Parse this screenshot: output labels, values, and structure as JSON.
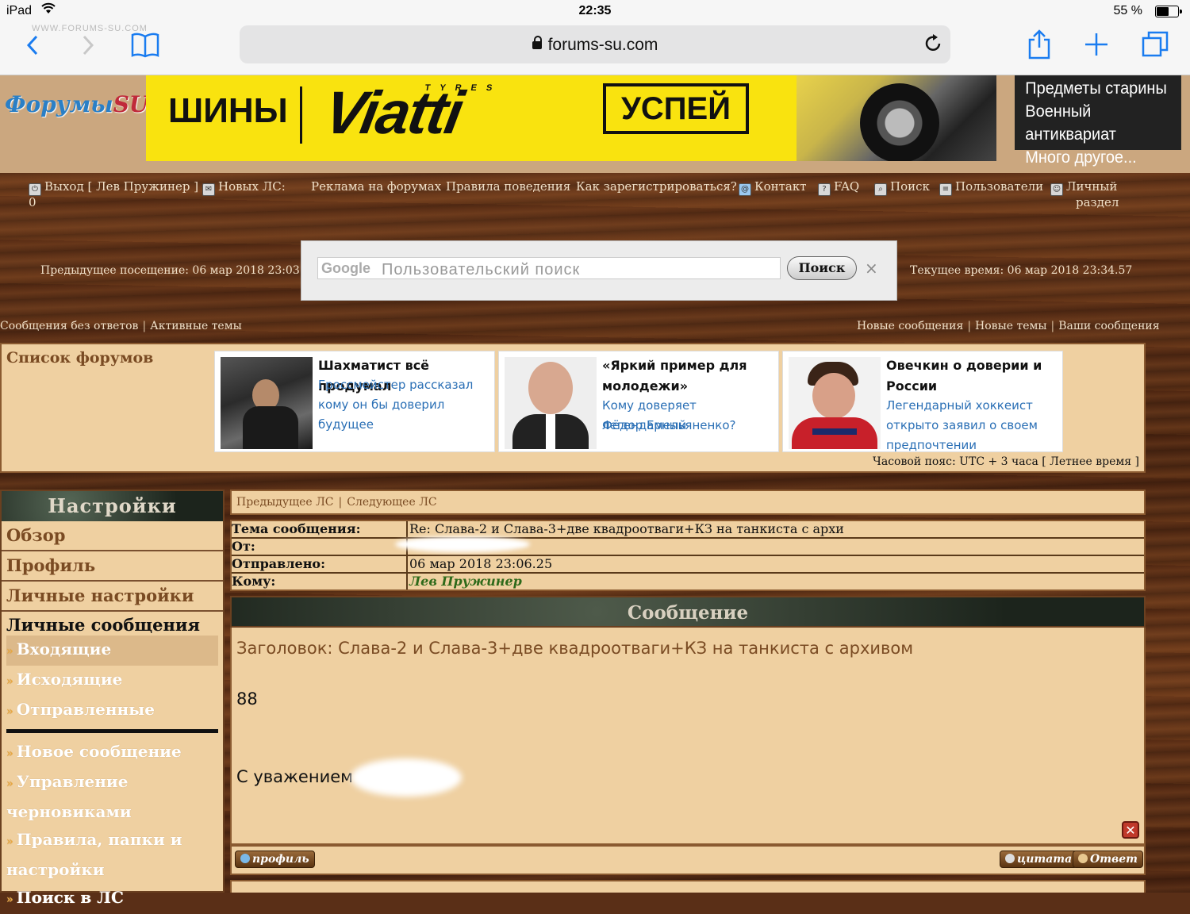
{
  "status": {
    "device": "iPad",
    "time": "22:35",
    "battery": "55 %"
  },
  "browser": {
    "watermark": "WWW.FORUMS-SU.COM",
    "url": "forums-su.com"
  },
  "banner": {
    "logo_main": "Форумы",
    "logo_accent": "SU",
    "ad_word": "ШИНЫ",
    "ad_brand": "Viatti",
    "ad_brand_sub": "TYRES",
    "ad_cta": "УСПЕЙ",
    "side_ad": [
      "Предметы старины",
      "Военный антиквариат",
      "Много другое..."
    ]
  },
  "topnav": {
    "logout": "Выход [ Лев Пружинер ]",
    "new_pm": "Новых ЛС:",
    "new_pm_count": "0",
    "ads": "Реклама на форумах",
    "rules": "Правила поведения",
    "register": "Как зарегистрироваться?",
    "contact": "Контакт",
    "faq": "FAQ",
    "search": "Поиск",
    "users": "Пользователи",
    "personal_1": "Личный",
    "personal_2": "раздел"
  },
  "visit": {
    "previous": "Предыдущее посещение: 06 мар 2018 23:03.56",
    "current": "Текущее время: 06 мар 2018 23:34.57"
  },
  "gsearch": {
    "logo": "Google",
    "placeholder": "Пользовательский поиск",
    "button": "Поиск",
    "clear": "×"
  },
  "sublinks": {
    "left": [
      "Сообщения без ответов",
      "Активные темы"
    ],
    "right": [
      "Новые сообщения",
      "Новые темы",
      "Ваши сообщения"
    ]
  },
  "forumlist": {
    "title": "Список форумов",
    "cards": [
      {
        "headline": "Шахматист всё продумал",
        "desc": [
          "Гроссмейстер рассказал",
          "кому он бы доверил",
          "будущее"
        ]
      },
      {
        "headline_1": "«Яркий пример для",
        "headline_2": "молодежи»",
        "desc": [
          "Кому доверяет легендарный",
          "Фёдор Емельяненко?"
        ]
      },
      {
        "headline_1": "Овечкин о доверии и",
        "headline_2": "России",
        "desc": [
          "Легендарный хоккеист",
          "открыто заявил о своем",
          "предпочтении"
        ]
      }
    ],
    "timezone": "Часовой пояс: UTC + 3 часа [ Летнее время ]"
  },
  "sidebar": {
    "header": "Настройки",
    "overview": "Обзор",
    "profile": "Профиль",
    "personal_settings": "Личные настройки",
    "pm": "Личные сообщения",
    "inbox": "Входящие",
    "outbox": "Исходящие",
    "sent": "Отправленные",
    "compose": "Новое сообщение",
    "drafts_1": "Управление",
    "drafts_2": "черновиками",
    "rules_1": "Правила, папки и",
    "rules_2": "настройки",
    "search_pm": "Поиск в ЛС",
    "arrow": "»"
  },
  "pm": {
    "prev": "Предыдущее ЛС",
    "next": "Следующее ЛС",
    "subject_label": "Тема сообщения:",
    "subject_value": "Re: Слава-2 и Слава-3+две квадроотваги+КЗ на танкиста с архи",
    "from_label": "От:",
    "sent_label": "Отправлено:",
    "sent_value": "06 мар 2018 23:06.25",
    "to_label": "Кому:",
    "to_value": "Лев Пружинер",
    "message_header": "Сообщение",
    "body_subject": "Заголовок: Слава-2 и Слава-3+две квадроотваги+КЗ на танкиста с архивом",
    "body_number": "88",
    "body_regards": "С уважением",
    "btn_profile": "профиль",
    "btn_quote": "цитата",
    "btn_reply": "Ответ"
  },
  "colors": {
    "panel": "#efd0a1",
    "link_brown": "#7a4b23",
    "ad_yellow": "#f9e30f",
    "ios_blue": "#1a7cf0"
  }
}
